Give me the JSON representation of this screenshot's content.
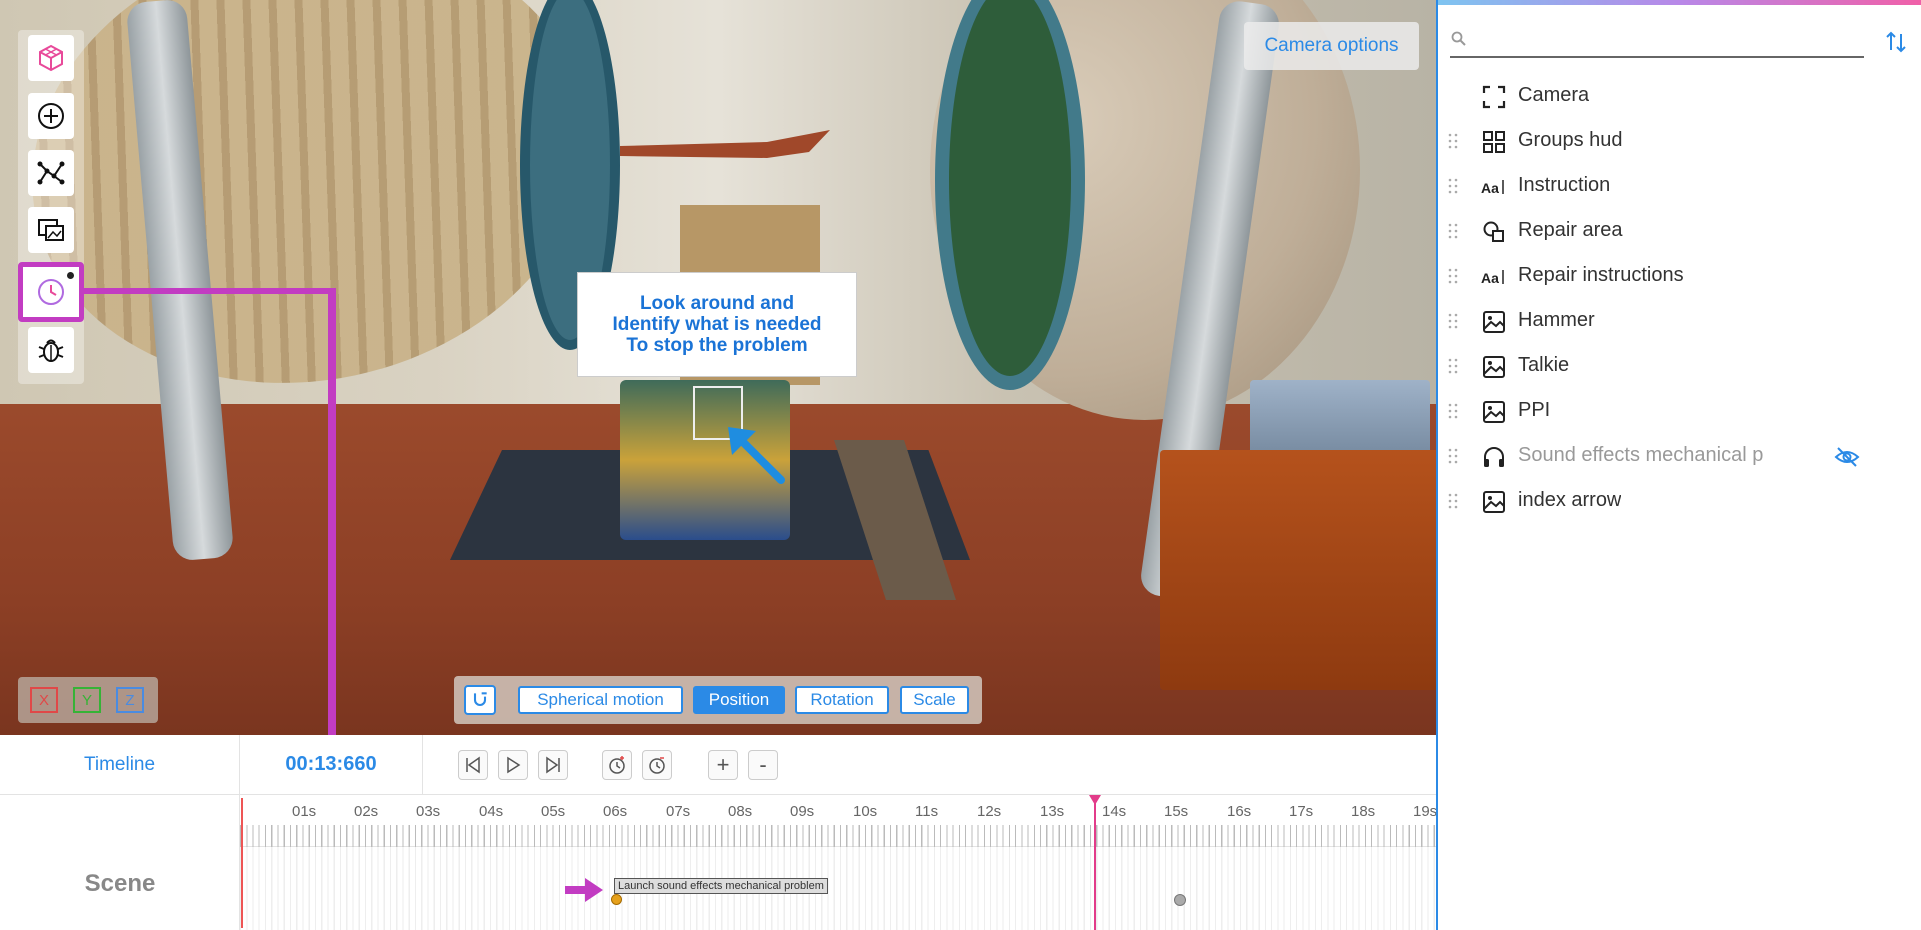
{
  "viewport": {
    "camera_options_label": "Camera options",
    "scene_instruction": "Look around and\nIdentify what is needed\nTo stop the problem",
    "axes": {
      "x": "X",
      "y": "Y",
      "z": "Z"
    },
    "transform": {
      "spherical_label": "Spherical motion",
      "position_label": "Position",
      "rotation_label": "Rotation",
      "scale_label": "Scale",
      "active": "Position"
    },
    "toolbar_icons": [
      "cube-icon",
      "add-circle-icon",
      "graph-icon",
      "media-icon",
      "clock-icon",
      "bug-icon"
    ]
  },
  "timeline": {
    "title": "Timeline",
    "current_time": "00:13:660",
    "zoom_in_label": "+",
    "zoom_out_label": "-",
    "ticks": [
      "01s",
      "02s",
      "03s",
      "04s",
      "05s",
      "06s",
      "07s",
      "08s",
      "09s",
      "10s",
      "11s",
      "12s",
      "13s",
      "14s",
      "15s",
      "16s",
      "17s",
      "18s",
      "19s"
    ],
    "track_label": "Scene",
    "event_label": "Launch sound effects mechanical problem"
  },
  "layers_panel": {
    "search_placeholder": "",
    "items": [
      {
        "name": "Camera",
        "icon": "camera-frame-icon",
        "hidden": false
      },
      {
        "name": "Groups hud",
        "icon": "grid-icon",
        "hidden": false
      },
      {
        "name": "Instruction",
        "icon": "text-icon",
        "hidden": false
      },
      {
        "name": "Repair area",
        "icon": "shapes-icon",
        "hidden": false
      },
      {
        "name": "Repair instructions",
        "icon": "text-icon",
        "hidden": false
      },
      {
        "name": "Hammer",
        "icon": "image-icon",
        "hidden": false
      },
      {
        "name": "Talkie",
        "icon": "image-icon",
        "hidden": false
      },
      {
        "name": "PPI",
        "icon": "image-icon",
        "hidden": false
      },
      {
        "name": "Sound effects mechanical p",
        "icon": "headphones-icon",
        "hidden": true
      },
      {
        "name": "index arrow",
        "icon": "image-icon",
        "hidden": false
      }
    ]
  },
  "colors": {
    "accent": "#2b8ae6",
    "annotation": "#c23cc2",
    "playhead": "#e23c8a"
  }
}
